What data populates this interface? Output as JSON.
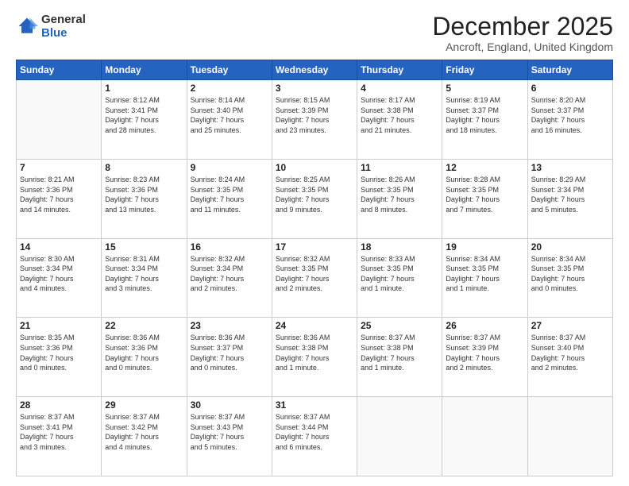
{
  "logo": {
    "line1": "General",
    "line2": "Blue"
  },
  "header": {
    "title": "December 2025",
    "subtitle": "Ancroft, England, United Kingdom"
  },
  "days": [
    "Sunday",
    "Monday",
    "Tuesday",
    "Wednesday",
    "Thursday",
    "Friday",
    "Saturday"
  ],
  "weeks": [
    [
      {
        "day": "",
        "content": ""
      },
      {
        "day": "1",
        "content": "Sunrise: 8:12 AM\nSunset: 3:41 PM\nDaylight: 7 hours\nand 28 minutes."
      },
      {
        "day": "2",
        "content": "Sunrise: 8:14 AM\nSunset: 3:40 PM\nDaylight: 7 hours\nand 25 minutes."
      },
      {
        "day": "3",
        "content": "Sunrise: 8:15 AM\nSunset: 3:39 PM\nDaylight: 7 hours\nand 23 minutes."
      },
      {
        "day": "4",
        "content": "Sunrise: 8:17 AM\nSunset: 3:38 PM\nDaylight: 7 hours\nand 21 minutes."
      },
      {
        "day": "5",
        "content": "Sunrise: 8:19 AM\nSunset: 3:37 PM\nDaylight: 7 hours\nand 18 minutes."
      },
      {
        "day": "6",
        "content": "Sunrise: 8:20 AM\nSunset: 3:37 PM\nDaylight: 7 hours\nand 16 minutes."
      }
    ],
    [
      {
        "day": "7",
        "content": "Sunrise: 8:21 AM\nSunset: 3:36 PM\nDaylight: 7 hours\nand 14 minutes."
      },
      {
        "day": "8",
        "content": "Sunrise: 8:23 AM\nSunset: 3:36 PM\nDaylight: 7 hours\nand 13 minutes."
      },
      {
        "day": "9",
        "content": "Sunrise: 8:24 AM\nSunset: 3:35 PM\nDaylight: 7 hours\nand 11 minutes."
      },
      {
        "day": "10",
        "content": "Sunrise: 8:25 AM\nSunset: 3:35 PM\nDaylight: 7 hours\nand 9 minutes."
      },
      {
        "day": "11",
        "content": "Sunrise: 8:26 AM\nSunset: 3:35 PM\nDaylight: 7 hours\nand 8 minutes."
      },
      {
        "day": "12",
        "content": "Sunrise: 8:28 AM\nSunset: 3:35 PM\nDaylight: 7 hours\nand 7 minutes."
      },
      {
        "day": "13",
        "content": "Sunrise: 8:29 AM\nSunset: 3:34 PM\nDaylight: 7 hours\nand 5 minutes."
      }
    ],
    [
      {
        "day": "14",
        "content": "Sunrise: 8:30 AM\nSunset: 3:34 PM\nDaylight: 7 hours\nand 4 minutes."
      },
      {
        "day": "15",
        "content": "Sunrise: 8:31 AM\nSunset: 3:34 PM\nDaylight: 7 hours\nand 3 minutes."
      },
      {
        "day": "16",
        "content": "Sunrise: 8:32 AM\nSunset: 3:34 PM\nDaylight: 7 hours\nand 2 minutes."
      },
      {
        "day": "17",
        "content": "Sunrise: 8:32 AM\nSunset: 3:35 PM\nDaylight: 7 hours\nand 2 minutes."
      },
      {
        "day": "18",
        "content": "Sunrise: 8:33 AM\nSunset: 3:35 PM\nDaylight: 7 hours\nand 1 minute."
      },
      {
        "day": "19",
        "content": "Sunrise: 8:34 AM\nSunset: 3:35 PM\nDaylight: 7 hours\nand 1 minute."
      },
      {
        "day": "20",
        "content": "Sunrise: 8:34 AM\nSunset: 3:35 PM\nDaylight: 7 hours\nand 0 minutes."
      }
    ],
    [
      {
        "day": "21",
        "content": "Sunrise: 8:35 AM\nSunset: 3:36 PM\nDaylight: 7 hours\nand 0 minutes."
      },
      {
        "day": "22",
        "content": "Sunrise: 8:36 AM\nSunset: 3:36 PM\nDaylight: 7 hours\nand 0 minutes."
      },
      {
        "day": "23",
        "content": "Sunrise: 8:36 AM\nSunset: 3:37 PM\nDaylight: 7 hours\nand 0 minutes."
      },
      {
        "day": "24",
        "content": "Sunrise: 8:36 AM\nSunset: 3:38 PM\nDaylight: 7 hours\nand 1 minute."
      },
      {
        "day": "25",
        "content": "Sunrise: 8:37 AM\nSunset: 3:38 PM\nDaylight: 7 hours\nand 1 minute."
      },
      {
        "day": "26",
        "content": "Sunrise: 8:37 AM\nSunset: 3:39 PM\nDaylight: 7 hours\nand 2 minutes."
      },
      {
        "day": "27",
        "content": "Sunrise: 8:37 AM\nSunset: 3:40 PM\nDaylight: 7 hours\nand 2 minutes."
      }
    ],
    [
      {
        "day": "28",
        "content": "Sunrise: 8:37 AM\nSunset: 3:41 PM\nDaylight: 7 hours\nand 3 minutes."
      },
      {
        "day": "29",
        "content": "Sunrise: 8:37 AM\nSunset: 3:42 PM\nDaylight: 7 hours\nand 4 minutes."
      },
      {
        "day": "30",
        "content": "Sunrise: 8:37 AM\nSunset: 3:43 PM\nDaylight: 7 hours\nand 5 minutes."
      },
      {
        "day": "31",
        "content": "Sunrise: 8:37 AM\nSunset: 3:44 PM\nDaylight: 7 hours\nand 6 minutes."
      },
      {
        "day": "",
        "content": ""
      },
      {
        "day": "",
        "content": ""
      },
      {
        "day": "",
        "content": ""
      }
    ]
  ]
}
